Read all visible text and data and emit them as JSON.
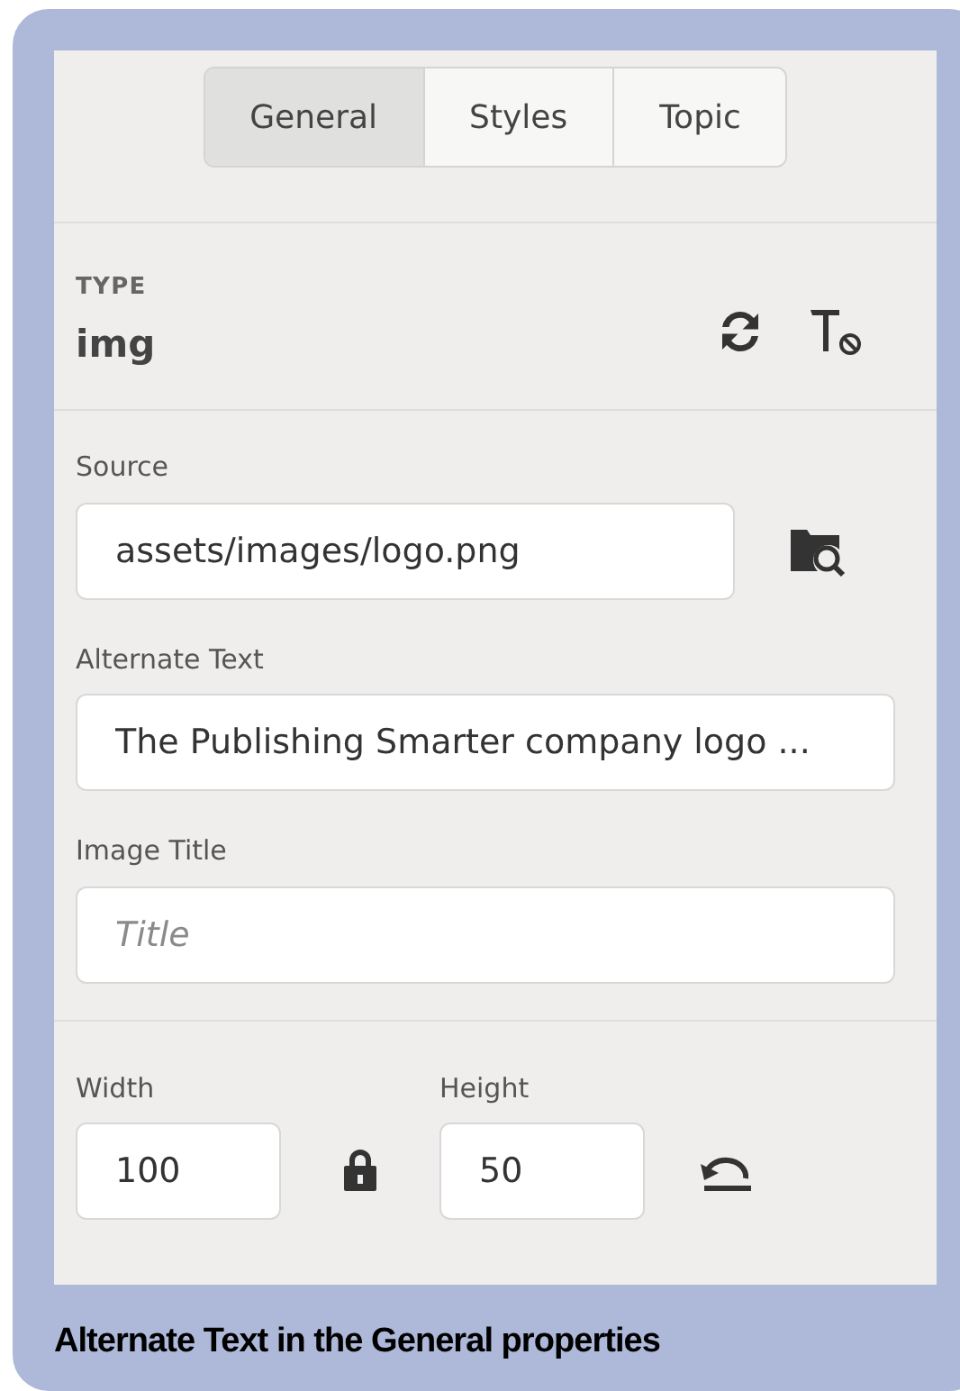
{
  "tabs": [
    {
      "label": "General",
      "selected": true
    },
    {
      "label": "Styles",
      "selected": false
    },
    {
      "label": "Topic",
      "selected": false
    }
  ],
  "type": {
    "label": "TYPE",
    "value": "img"
  },
  "source": {
    "label": "Source",
    "value": "assets/images/logo.png"
  },
  "alternate_text": {
    "label": "Alternate Text",
    "value": "The Publishing Smarter company logo ..."
  },
  "image_title": {
    "label": "Image Title",
    "placeholder": "Title"
  },
  "width": {
    "label": "Width",
    "value": "100"
  },
  "height": {
    "label": "Height",
    "value": "50"
  },
  "caption": "Alternate Text in the General properties"
}
